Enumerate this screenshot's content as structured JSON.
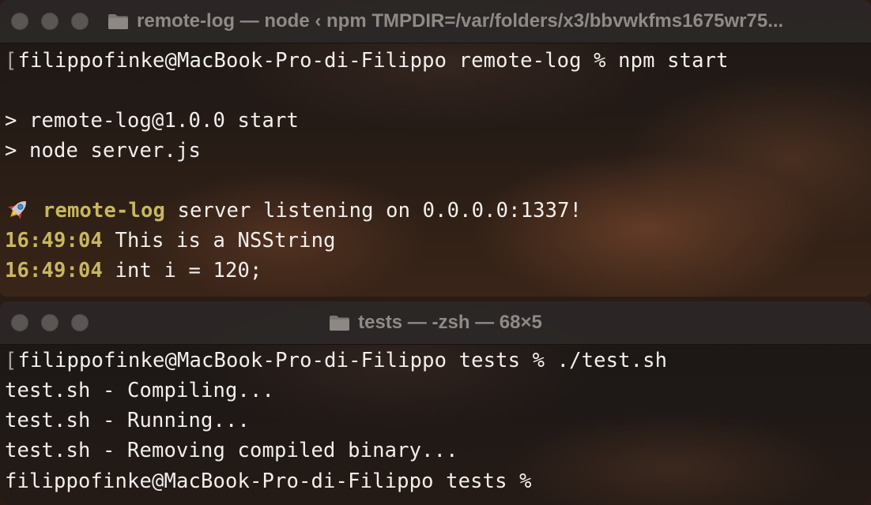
{
  "windows": {
    "top": {
      "title": "remote-log — node ‹ npm TMPDIR=/var/folders/x3/bbvwkfms1675wr75...",
      "lines": {
        "prompt_user": "filippofinke@MacBook-Pro-di-Filippo remote-log % npm start",
        "npm_script_name": "> remote-log@1.0.0 start",
        "npm_script_cmd": "> node server.js",
        "server_name": "remote-log",
        "server_message": " server listening on 0.0.0.0:1337!",
        "log1_time": "16:49:04",
        "log1_message": " This is a NSString",
        "log2_time": "16:49:04",
        "log2_message": " int i = 120;"
      },
      "icons": {
        "title": "folder-icon",
        "status": "rocket-icon"
      }
    },
    "bottom": {
      "title": "tests — -zsh — 68×5",
      "lines": {
        "prompt_cmd": "filippofinke@MacBook-Pro-di-Filippo tests % ./test.sh",
        "compiling": "test.sh - Compiling...",
        "running": "test.sh - Running...",
        "removing": "test.sh - Removing compiled binary...",
        "prompt_idle": "filippofinke@MacBook-Pro-di-Filippo tests % "
      },
      "icons": {
        "title": "folder-icon"
      }
    }
  },
  "colors": {
    "accent": "#c8b760",
    "text": "#f2efec",
    "title_text": "#8f8a86",
    "traffic_light": "#5a5653"
  }
}
